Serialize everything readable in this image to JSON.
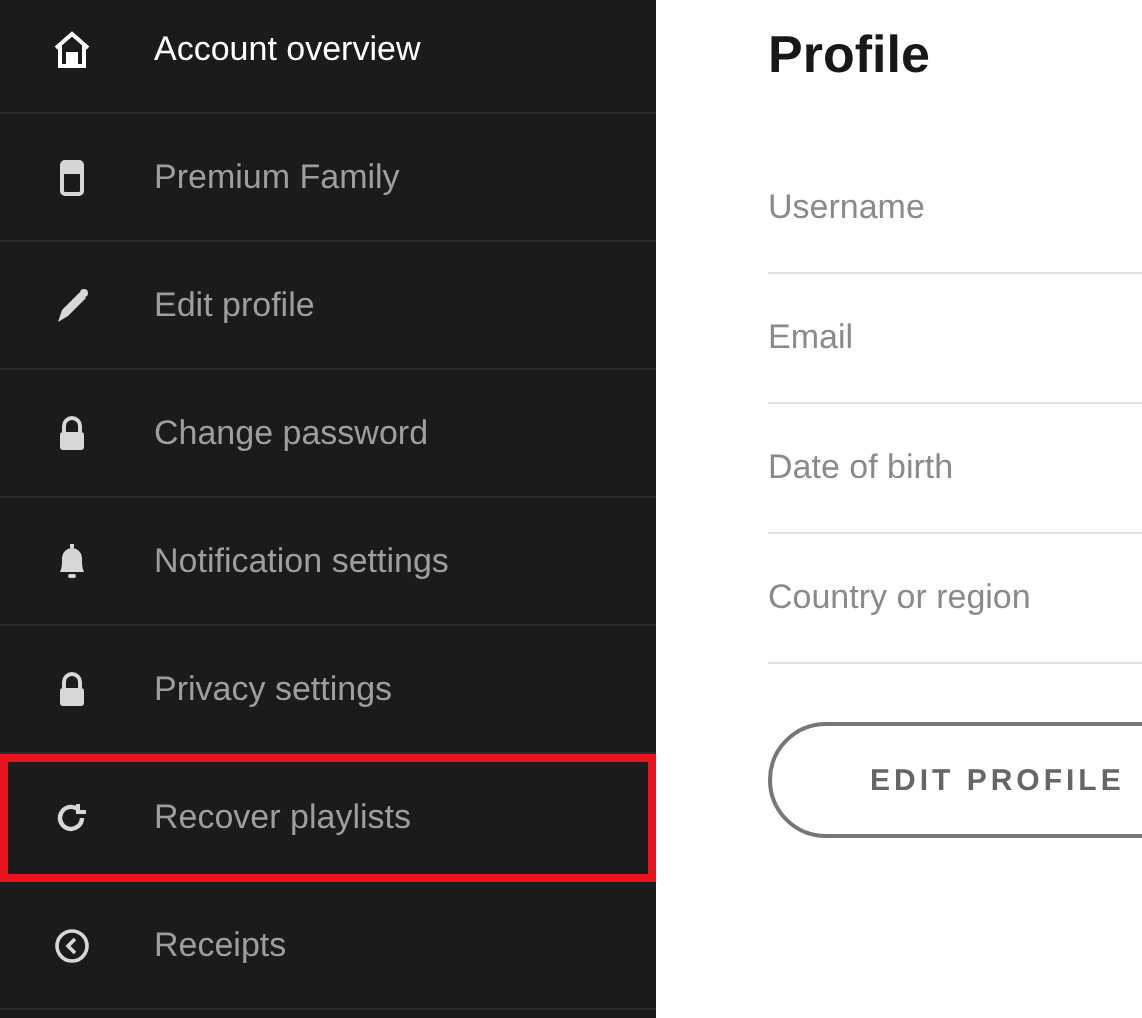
{
  "sidebar": {
    "items": [
      {
        "label": "Account overview",
        "selected": true,
        "highlighted": false
      },
      {
        "label": "Premium Family",
        "selected": false,
        "highlighted": false
      },
      {
        "label": "Edit profile",
        "selected": false,
        "highlighted": false
      },
      {
        "label": "Change password",
        "selected": false,
        "highlighted": false
      },
      {
        "label": "Notification settings",
        "selected": false,
        "highlighted": false
      },
      {
        "label": "Privacy settings",
        "selected": false,
        "highlighted": false
      },
      {
        "label": "Recover playlists",
        "selected": false,
        "highlighted": true
      },
      {
        "label": "Receipts",
        "selected": false,
        "highlighted": false
      }
    ]
  },
  "profile": {
    "title": "Profile",
    "fields": [
      {
        "label": "Username"
      },
      {
        "label": "Email"
      },
      {
        "label": "Date of birth"
      },
      {
        "label": "Country or region"
      }
    ],
    "button": "EDIT PROFILE"
  }
}
